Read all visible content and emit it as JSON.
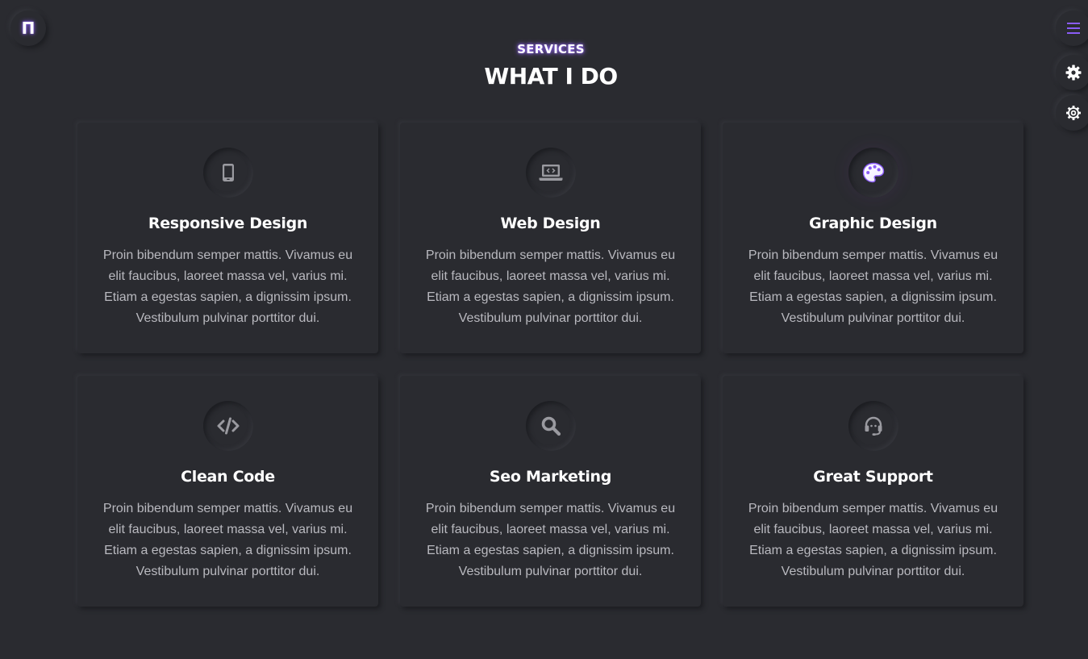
{
  "logo": {
    "glyph": "Π",
    "accent": "#8a5cf6"
  },
  "side_controls": [
    {
      "name": "menu",
      "icon": "hamburger-menu-icon",
      "color": "#8a5cf6"
    },
    {
      "name": "style",
      "icon": "cog-filled-icon",
      "color": "#ffffff"
    },
    {
      "name": "settings",
      "icon": "gear-outline-icon",
      "color": "#ffffff"
    }
  ],
  "section": {
    "subtitle": "SERVICES",
    "title": "WHAT I DO"
  },
  "services": [
    {
      "icon": "smartphone-icon",
      "title": "Responsive Design",
      "text": "Proin bibendum semper mattis. Vivamus eu elit faucibus, laoreet massa vel, varius mi. Etiam a egestas sapien, a dignissim ipsum. Vestibulum pulvinar porttitor dui."
    },
    {
      "icon": "laptop-code-icon",
      "title": "Web Design",
      "text": "Proin bibendum semper mattis. Vivamus eu elit faucibus, laoreet massa vel, varius mi. Etiam a egestas sapien, a dignissim ipsum. Vestibulum pulvinar porttitor dui."
    },
    {
      "icon": "palette-icon",
      "title": "Graphic Design",
      "text": "Proin bibendum semper mattis. Vivamus eu elit faucibus, laoreet massa vel, varius mi. Etiam a egestas sapien, a dignissim ipsum. Vestibulum pulvinar porttitor dui."
    },
    {
      "icon": "code-icon",
      "title": "Clean Code",
      "text": "Proin bibendum semper mattis. Vivamus eu elit faucibus, laoreet massa vel, varius mi. Etiam a egestas sapien, a dignissim ipsum. Vestibulum pulvinar porttitor dui."
    },
    {
      "icon": "search-icon",
      "title": "Seo Marketing",
      "text": "Proin bibendum semper mattis. Vivamus eu elit faucibus, laoreet massa vel, varius mi. Etiam a egestas sapien, a dignissim ipsum. Vestibulum pulvinar porttitor dui."
    },
    {
      "icon": "headset-icon",
      "title": "Great Support",
      "text": "Proin bibendum semper mattis. Vivamus eu elit faucibus, laoreet massa vel, varius mi. Etiam a egestas sapien, a dignissim ipsum. Vestibulum pulvinar porttitor dui."
    }
  ],
  "colors": {
    "background": "#2a2b30",
    "accent": "#8a5cf6",
    "text_muted": "#b9b9bf",
    "icon_gray": "#9a9aa0"
  }
}
